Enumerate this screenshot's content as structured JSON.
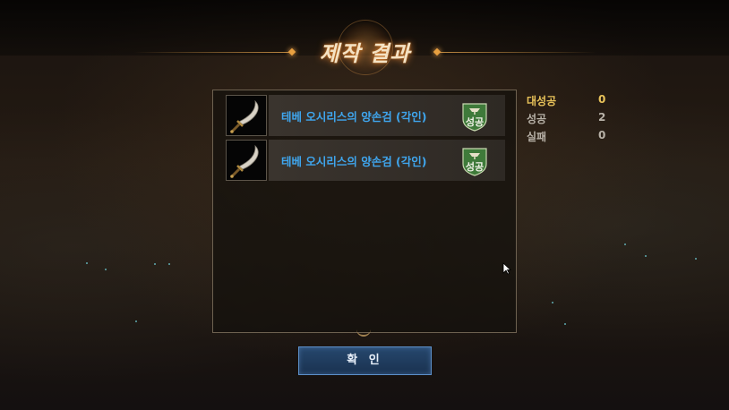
{
  "dialog": {
    "title": "제작 결과",
    "results": [
      {
        "name": "테베 오시리스의 양손검 (각인)",
        "status": "성공",
        "icon": "two-handed-sword"
      },
      {
        "name": "테베 오시리스의 양손검 (각인)",
        "status": "성공",
        "icon": "two-handed-sword"
      }
    ],
    "stats": [
      {
        "label": "대성공",
        "value": "0"
      },
      {
        "label": "성공",
        "value": "2"
      },
      {
        "label": "실패",
        "value": "0"
      }
    ],
    "confirm_label": "확 인"
  },
  "colors": {
    "item_name": "#3fa6ee",
    "great_success": "#e9c35a",
    "success_badge": "#3f7a3a",
    "confirm_button": "#1f3c5f"
  }
}
